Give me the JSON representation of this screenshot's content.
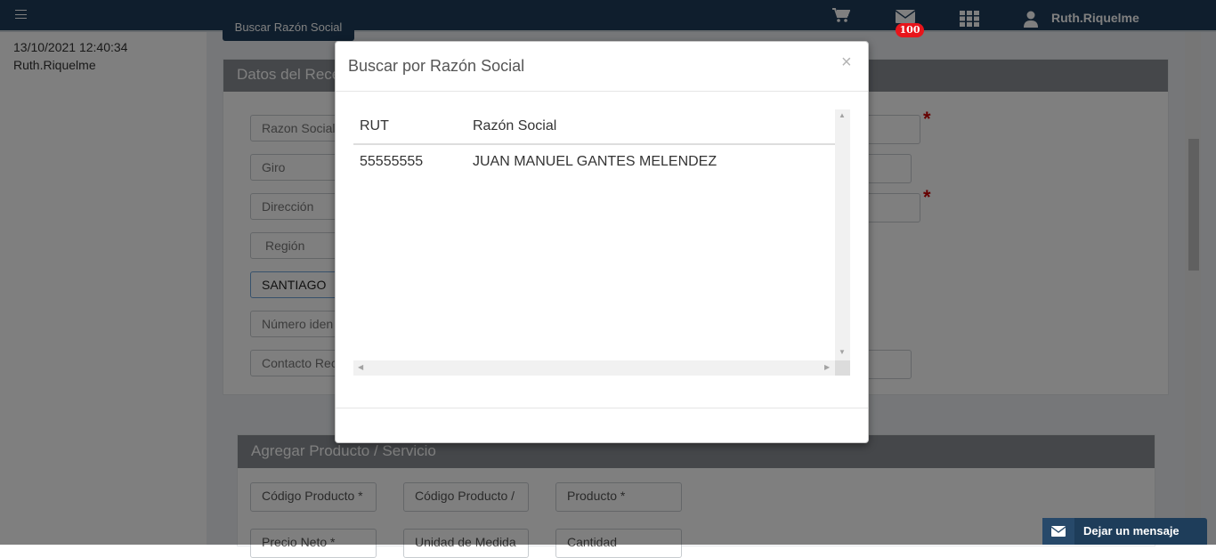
{
  "header": {
    "user_name": "Ruth.Riquelme",
    "mail_badge": "100",
    "icons": [
      "menu-icon",
      "cart-icon",
      "mail-icon",
      "apps-grid-icon",
      "user-icon"
    ]
  },
  "sidebar": {
    "datetime": "13/10/2021 12:40:34",
    "user": "Ruth.Riquelme"
  },
  "background_form": {
    "search_button_label": "Buscar Razón Social",
    "receptor_panel_title": "Datos del Rece",
    "fields": {
      "razon_social": "Razon Social",
      "giro": "Giro",
      "direccion": "Dirección",
      "region": "Región",
      "comuna_value": "SANTIAGO",
      "numero_identificacion": "Número iden",
      "contacto": "Contacto Rec"
    },
    "product_panel_title": "Agregar Producto / Servicio",
    "product_fields": {
      "codigo_producto": "Código Producto *",
      "codigo_producto_2": "Código Producto /",
      "producto": "Producto *",
      "precio_neto": "Precio Neto *",
      "unidad_medida": "Unidad de Medida",
      "cantidad": "Cantidad"
    }
  },
  "modal": {
    "title": "Buscar por Razón Social",
    "close_label": "×",
    "columns": [
      "RUT",
      "Razón Social"
    ],
    "rows": [
      {
        "rut": "55555555",
        "razon_social": "JUAN MANUEL GANTES MELENDEZ"
      }
    ]
  },
  "chat_widget": {
    "label": "Dejar un mensaje"
  },
  "colors": {
    "navbar": "#1e3d5a",
    "badge": "#e8151b",
    "panel_header": "#8a8f94",
    "required": "#cc0000"
  }
}
